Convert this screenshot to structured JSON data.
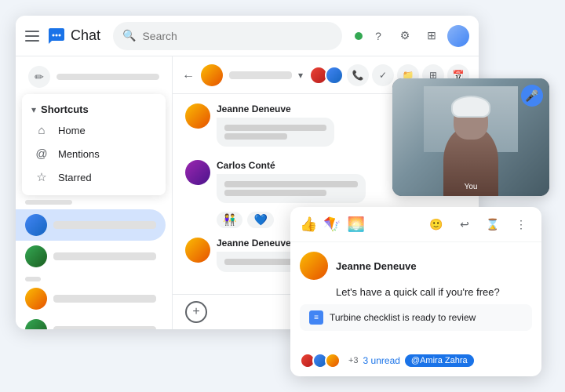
{
  "app": {
    "title": "Chat",
    "logo_color": "#1a73e8"
  },
  "topbar": {
    "search_placeholder": "Search",
    "status_color": "#34a853",
    "question_icon": "?",
    "settings_icon": "⚙",
    "apps_icon": "⊞"
  },
  "shortcuts": {
    "section_label": "Shortcuts",
    "chevron": "▾",
    "items": [
      {
        "label": "Home",
        "icon": "⌂"
      },
      {
        "label": "Mentions",
        "icon": "@"
      },
      {
        "label": "Starred",
        "icon": "☆"
      }
    ]
  },
  "chat_contact": {
    "name_placeholder": "Contact name"
  },
  "messages": [
    {
      "sender": "Jeanne Deneuve",
      "lines": [
        "medium",
        "short"
      ]
    },
    {
      "sender": "Carlos Conté",
      "lines": [
        "long",
        "medium"
      ]
    }
  ],
  "reactions": [
    "👫",
    "💙"
  ],
  "message2": {
    "sender": "Jeanne Deneuve",
    "lines": [
      "medium"
    ]
  },
  "video": {
    "label": "You",
    "mic_icon": "🎤"
  },
  "notification": {
    "sender": "Jeanne Deneuve",
    "message": "Let's have a quick call if you're free?",
    "attachment_label": "Turbine checklist",
    "attachment_suffix": " is ready to review",
    "footer_count": "+3",
    "unread_label": "3 unread",
    "tag_label": "@Amira Zahra",
    "emoji_btn": "👍",
    "emoji_btn2": "🪁",
    "emoji_btn3": "🌅",
    "reply_icon": "↩",
    "hourglass_icon": "⌛",
    "more_icon": "⋮",
    "smile_icon": "🙂"
  }
}
